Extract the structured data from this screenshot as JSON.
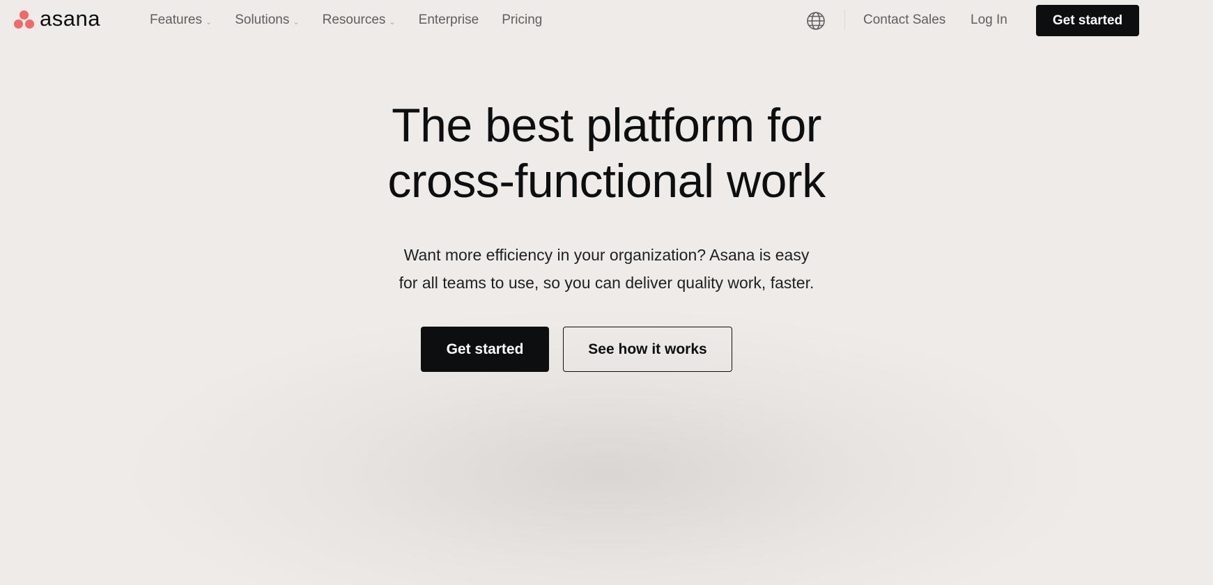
{
  "brand": {
    "name": "asana",
    "logo_color": "#f06a6a"
  },
  "nav": {
    "items": [
      {
        "label": "Features",
        "has_dropdown": true
      },
      {
        "label": "Solutions",
        "has_dropdown": true
      },
      {
        "label": "Resources",
        "has_dropdown": true
      },
      {
        "label": "Enterprise",
        "has_dropdown": false
      },
      {
        "label": "Pricing",
        "has_dropdown": false
      }
    ],
    "dropdown_glyph": "⌄",
    "language_icon": "globe-icon",
    "contact_label": "Contact Sales",
    "login_label": "Log In",
    "cta_label": "Get started"
  },
  "hero": {
    "title_line1": "The best platform for",
    "title_line2": "cross-functional work",
    "subtitle_line1": "Want more efficiency in your organization? Asana is easy",
    "subtitle_line2": "for all teams to use, so you can deliver quality work, faster.",
    "primary_cta": "Get started",
    "secondary_cta": "See how it works"
  },
  "colors": {
    "background": "#efebe9",
    "text": "#0d0e10",
    "nav_text": "#5f5d5d",
    "button_dark": "#0d0e10"
  }
}
